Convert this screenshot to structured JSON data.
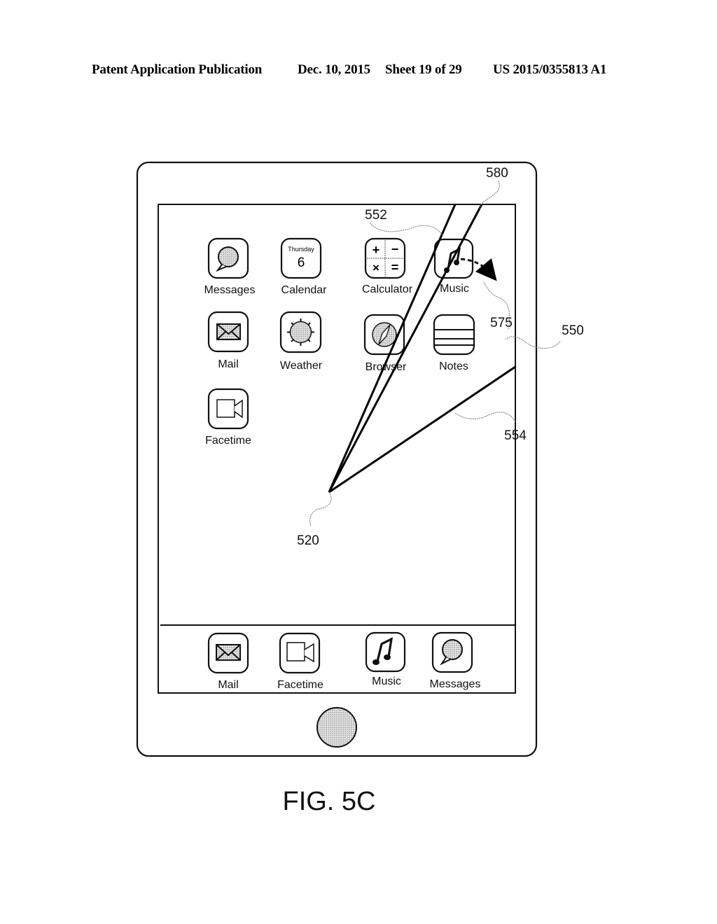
{
  "header": {
    "left": "Patent Application Publication",
    "date": "Dec. 10, 2015",
    "sheet": "Sheet 19 of 29",
    "pub_number": "US 2015/0355813 A1"
  },
  "figure": {
    "caption": "FIG. 5C",
    "home_screen": {
      "rows": [
        [
          {
            "label": "Messages",
            "icon": "speech-bubble-icon"
          },
          {
            "label": "Calendar",
            "icon": "calendar-icon",
            "day": "Thursday",
            "date": "6"
          },
          {
            "label": "Calculator",
            "icon": "calculator-icon",
            "symbols": [
              "+",
              "−",
              "×",
              "="
            ]
          },
          {
            "label": "Music",
            "icon": "music-note-icon"
          }
        ],
        [
          {
            "label": "Mail",
            "icon": "envelope-icon"
          },
          {
            "label": "Weather",
            "icon": "sun-icon"
          },
          {
            "label": "Browser",
            "icon": "compass-icon"
          },
          {
            "label": "Notes",
            "icon": "notes-icon"
          }
        ],
        [
          {
            "label": "Facetime",
            "icon": "video-camera-icon"
          }
        ]
      ],
      "dock": [
        {
          "label": "Mail",
          "icon": "envelope-icon"
        },
        {
          "label": "Facetime",
          "icon": "video-camera-icon"
        },
        {
          "label": "Music",
          "icon": "music-note-icon"
        },
        {
          "label": "Messages",
          "icon": "speech-bubble-icon"
        }
      ]
    },
    "reference_numerals": {
      "r580": "580",
      "r552": "552",
      "r575": "575",
      "r550": "550",
      "r554": "554",
      "r520": "520"
    }
  }
}
